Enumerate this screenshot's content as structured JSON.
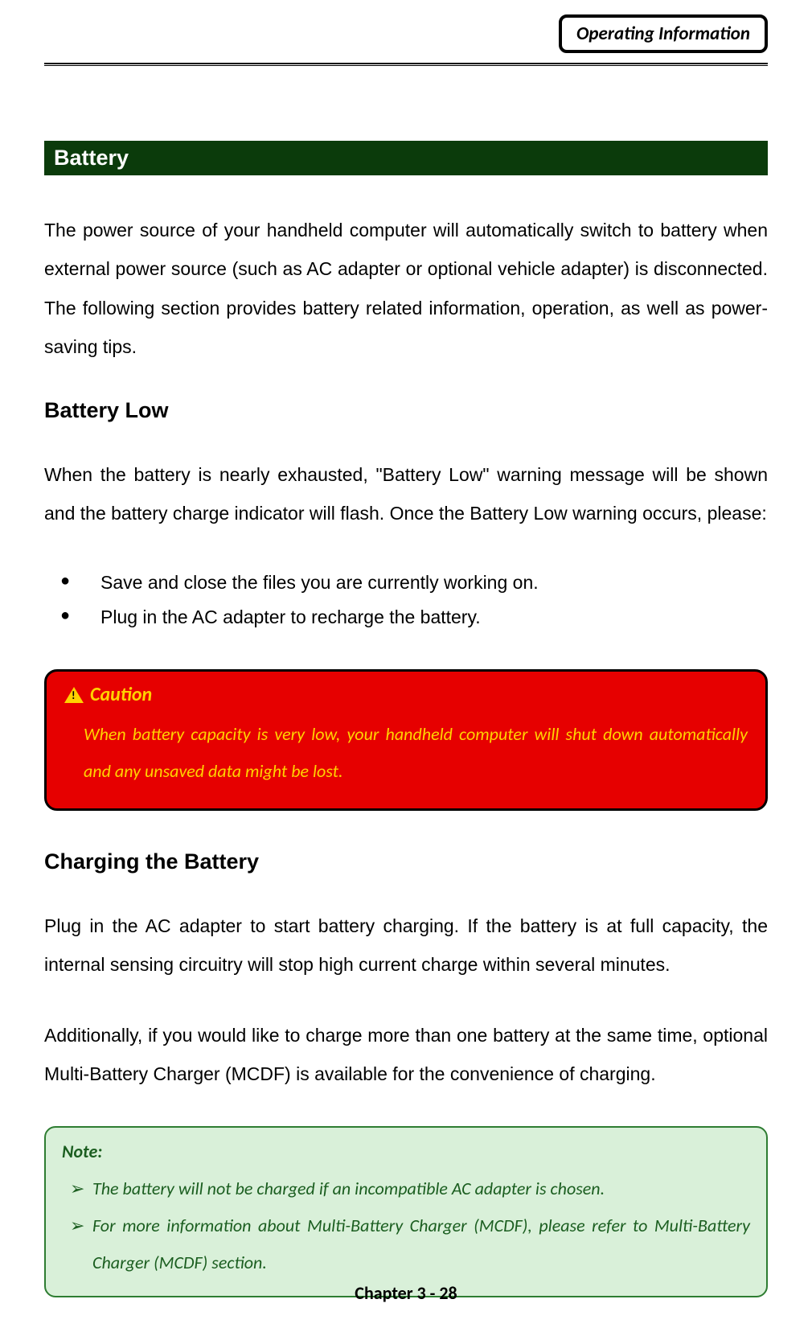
{
  "header": {
    "tab_label": "Operating Information"
  },
  "section": {
    "title": "Battery",
    "intro": "The power source of your handheld computer will automatically switch to battery when external power source (such as AC adapter or optional vehicle adapter) is disconnected. The following section provides battery related information, operation, as well as power-saving tips."
  },
  "battery_low": {
    "heading": "Battery Low",
    "para": "When the battery is nearly exhausted, \"Battery Low\" warning message will be shown and the battery charge indicator will flash. Once the Battery Low warning occurs, please:",
    "bullets": [
      "Save and close the files you are currently working on.",
      "Plug in the AC adapter to recharge the battery."
    ]
  },
  "caution": {
    "title": "Caution",
    "body": "When battery capacity is very low, your handheld computer will shut down automatically and any unsaved data might be lost."
  },
  "charging": {
    "heading": "Charging the Battery",
    "para1": "Plug in the AC adapter to start battery charging. If the battery is at full capacity, the internal sensing circuitry will stop high current charge within several minutes.",
    "para2": "Additionally, if you would like to charge more than one battery at the same time, optional Multi-Battery Charger (MCDF) is available for the convenience of charging."
  },
  "note": {
    "title": "Note:",
    "items": [
      "The battery will not be charged if an incompatible AC adapter is chosen.",
      "For more information about Multi-Battery Charger (MCDF), please refer to Multi-Battery Charger (MCDF) section."
    ]
  },
  "footer": {
    "text": "Chapter 3 - 28"
  }
}
